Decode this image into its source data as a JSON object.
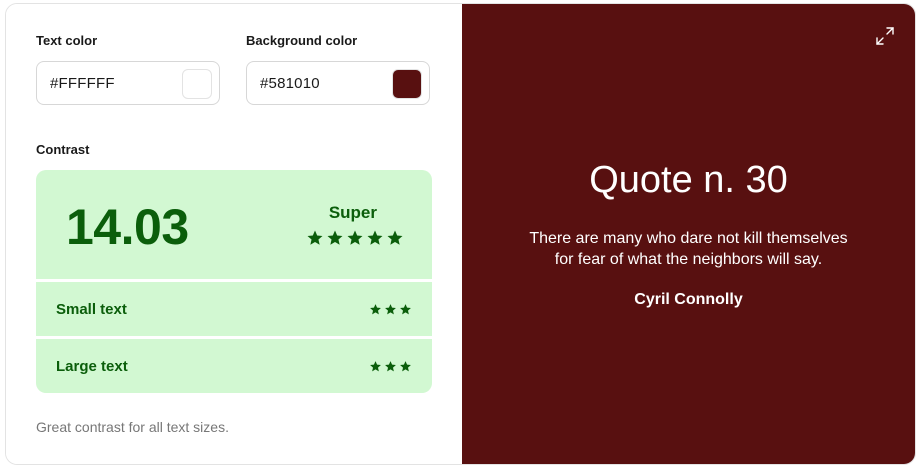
{
  "text_color": {
    "label": "Text color",
    "value": "#FFFFFF",
    "swatch": "#FFFFFF"
  },
  "background_color": {
    "label": "Background color",
    "value": "#581010",
    "swatch": "#581010"
  },
  "contrast": {
    "label": "Contrast",
    "ratio": "14.03",
    "rating": "Super",
    "rating_stars": 5,
    "rows": [
      {
        "label": "Small text",
        "stars": 3
      },
      {
        "label": "Large text",
        "stars": 3
      }
    ],
    "hint": "Great contrast for all text sizes."
  },
  "preview": {
    "title": "Quote n. 30",
    "quote_line_1": "There are many who dare not kill themselves",
    "quote_line_2": "for fear of what the neighbors will say.",
    "author": "Cyril Connolly",
    "expand_icon": "expand-icon"
  },
  "colors": {
    "panel_bg": "#d2f8d2",
    "panel_text": "#0b5e0b",
    "preview_bg": "#581010",
    "preview_text": "#FFFFFF"
  }
}
